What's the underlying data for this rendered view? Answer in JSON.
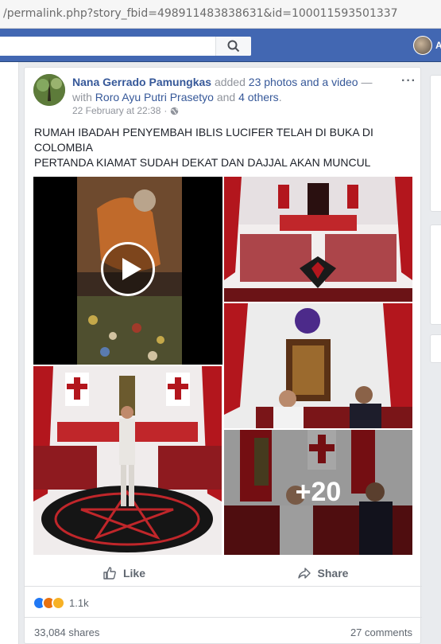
{
  "browser": {
    "url": "/permalink.php?story_fbid=498911483838631&id=100011593501337"
  },
  "topbar": {
    "user_initial": "A"
  },
  "post": {
    "author": "Nana Gerrado Pamungkas",
    "action_text": " added ",
    "photos_link": "23 photos and a video",
    "dash": " — with ",
    "tagged_user": "Roro Ayu Putri Prasetyo",
    "and_text": " and ",
    "others_link": "4 others",
    "period": ".",
    "timestamp": "22 February at 22:38",
    "separator": " · ",
    "privacy_icon": "globe-icon",
    "more_label": "···",
    "body_lines": [
      "RUMAH IBADAH PENYEMBAH IBLIS LUCIFER TELAH DI BUKA DI",
      "COLOMBIA",
      "PERTANDA KIAMAT SUDAH DEKAT DAN DAJJAL AKAN MUNCUL"
    ],
    "more_count": "+20"
  },
  "actions": {
    "like": "Like",
    "share": "Share"
  },
  "reactions": {
    "count": "1.1k",
    "types": [
      "like",
      "angry",
      "sad"
    ]
  },
  "stats": {
    "shares": "33,084 shares",
    "comments": "27 comments"
  },
  "colors": {
    "facebook_blue": "#4267b2",
    "link": "#365899",
    "meta_gray": "#90949c"
  }
}
